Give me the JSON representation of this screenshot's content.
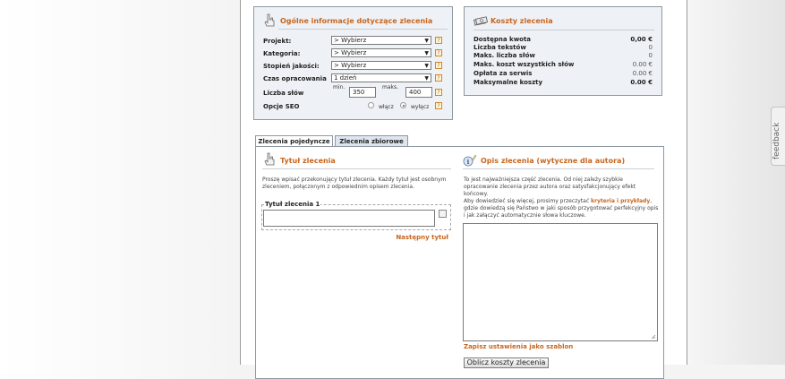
{
  "general": {
    "title": "Ogólne informacje dotyczące zlecenia",
    "project_label": "Projekt:",
    "project_value": "> Wybierz",
    "category_label": "Kategoria:",
    "category_value": "> Wybierz",
    "quality_label": "Stopień jakości:",
    "quality_value": "> Wybierz",
    "time_label": "Czas opracowania",
    "time_value": "1 dzień",
    "words_label": "Liczba słów",
    "min_label": "min.",
    "min_value": "350",
    "max_label": "maks.",
    "max_value": "400",
    "seo_label": "Opcje SEO",
    "seo_on": "włącz",
    "seo_off": "wyłącz",
    "help": "?"
  },
  "costs": {
    "title": "Koszty zlecenia",
    "rows": [
      {
        "label": "Dostępna kwota",
        "value": "0,00 €"
      },
      {
        "label": "Liczba tekstów",
        "value": "0"
      },
      {
        "label": "Maks. liczba słów",
        "value": "0"
      },
      {
        "label": "Maks. koszt wszystkich słów",
        "value": "0.00 €"
      },
      {
        "label": "Opłata za serwis",
        "value": "0.00 €"
      },
      {
        "label": "Maksymalne koszty",
        "value": "0.00 €"
      }
    ]
  },
  "tabs": {
    "single": "Zlecenia pojedyncze",
    "bulk": "Zlecenia zbiorowe"
  },
  "title_section": {
    "title": "Tytuł zlecenia",
    "desc": "Proszę wpisać przekonujący tytuł zlecenia. Każdy tytuł jest osobnym zleceniem, połączonym z odpowiednim opisem zlecenia.",
    "field_label": "Tytuł zlecenia 1",
    "next_link": "Następny tytuł"
  },
  "desc_section": {
    "title": "Opis zlecenia (wytyczne dla autora)",
    "desc_1": "To jest najważniejsza część zlecenia. Od niej zależy szybkie opracowanie zlecenia przez autora oraz satysfakcjonujący efekt końcowy.",
    "desc_2a": "Aby dowiedzieć się więcej, prosimy przeczytać ",
    "desc_link": "kryteria i przykłady",
    "desc_2b": ", gdzie dowiedzą się Państwo w jaki sposób przygotować perfekcyjny opis i jak załączyć automatycznie słowa kluczowe.",
    "save_template": "Zapisz ustawienia jako szablon",
    "calc_button": "Oblicz koszty zlecenia"
  },
  "feedback": "feedback",
  "icons": {
    "general": "hand-pointer-icon",
    "costs": "cash-icon",
    "title": "hand-pointer-icon",
    "desc": "info-pen-icon"
  }
}
